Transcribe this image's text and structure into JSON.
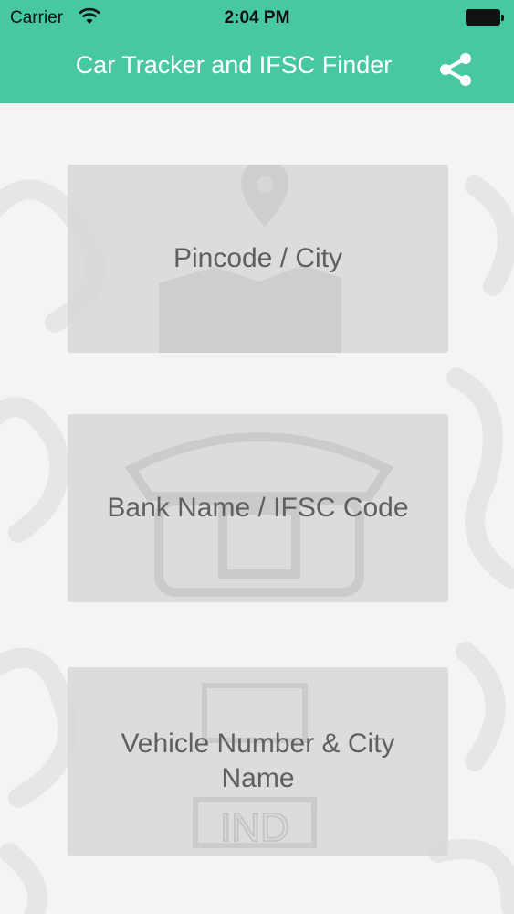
{
  "status_bar": {
    "carrier": "Carrier",
    "time": "2:04 PM"
  },
  "header": {
    "title": "Car Tracker and IFSC Finder",
    "background_color": "#47c7a2",
    "share_icon": "share-icon"
  },
  "menu": {
    "items": [
      {
        "label": "Pincode / City",
        "icon": "map-pin-icon"
      },
      {
        "label": "Bank Name / IFSC Code",
        "icon": "telephone-icon"
      },
      {
        "label": "Vehicle Number & City Name",
        "icon": "license-plate-icon"
      }
    ]
  },
  "watermark_plate_text": "IND"
}
